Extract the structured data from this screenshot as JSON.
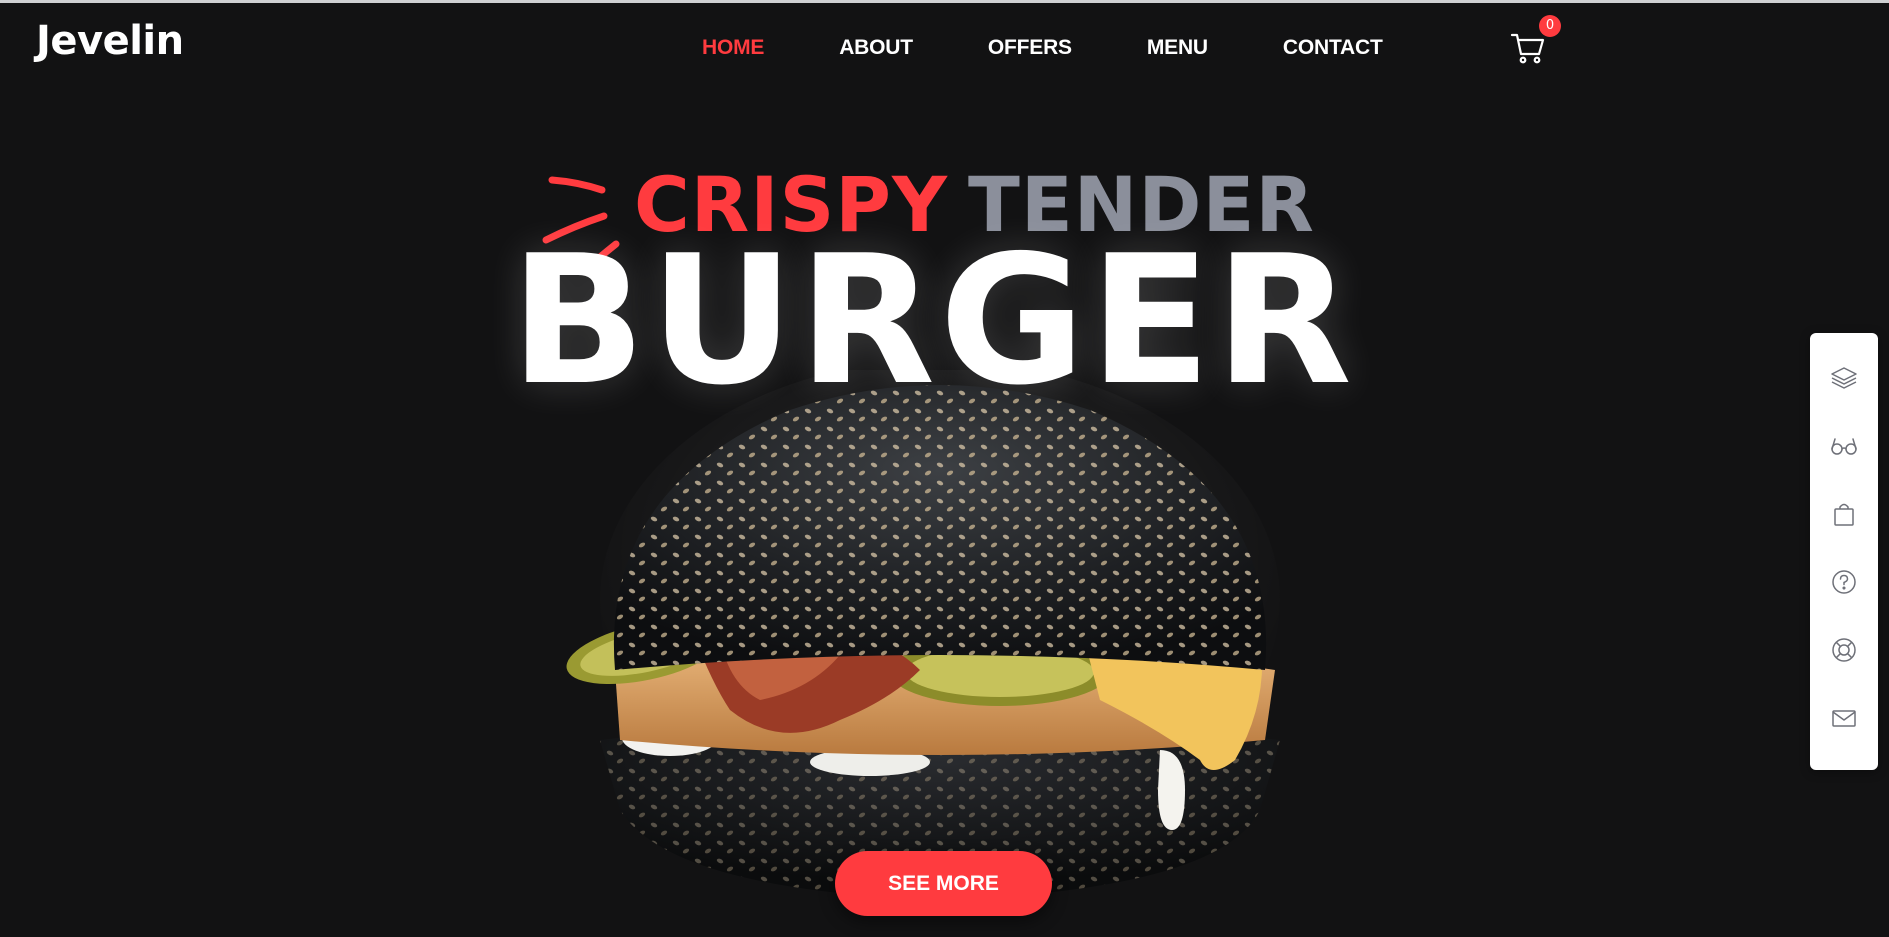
{
  "brand": {
    "logo": "Jevelin"
  },
  "nav": {
    "items": [
      {
        "label": "HOME",
        "active": true
      },
      {
        "label": "ABOUT",
        "active": false
      },
      {
        "label": "OFFERS",
        "active": false
      },
      {
        "label": "MENU",
        "active": false
      },
      {
        "label": "CONTACT",
        "active": false
      }
    ]
  },
  "cart": {
    "icon": "cart-icon",
    "count": "0"
  },
  "hero": {
    "headline_accent": "CRISPY",
    "headline_secondary": "TENDER",
    "headline_main": "BURGER",
    "cta_label": "SEE MORE"
  },
  "side_panel": {
    "icons": [
      "layers-icon",
      "glasses-icon",
      "shopping-bag-icon",
      "help-circle-icon",
      "life-ring-icon",
      "mail-icon"
    ]
  },
  "colors": {
    "background": "#121213",
    "accent": "#ff3b3f",
    "secondary_text": "#8b8f9b",
    "panel": "#ffffff"
  }
}
